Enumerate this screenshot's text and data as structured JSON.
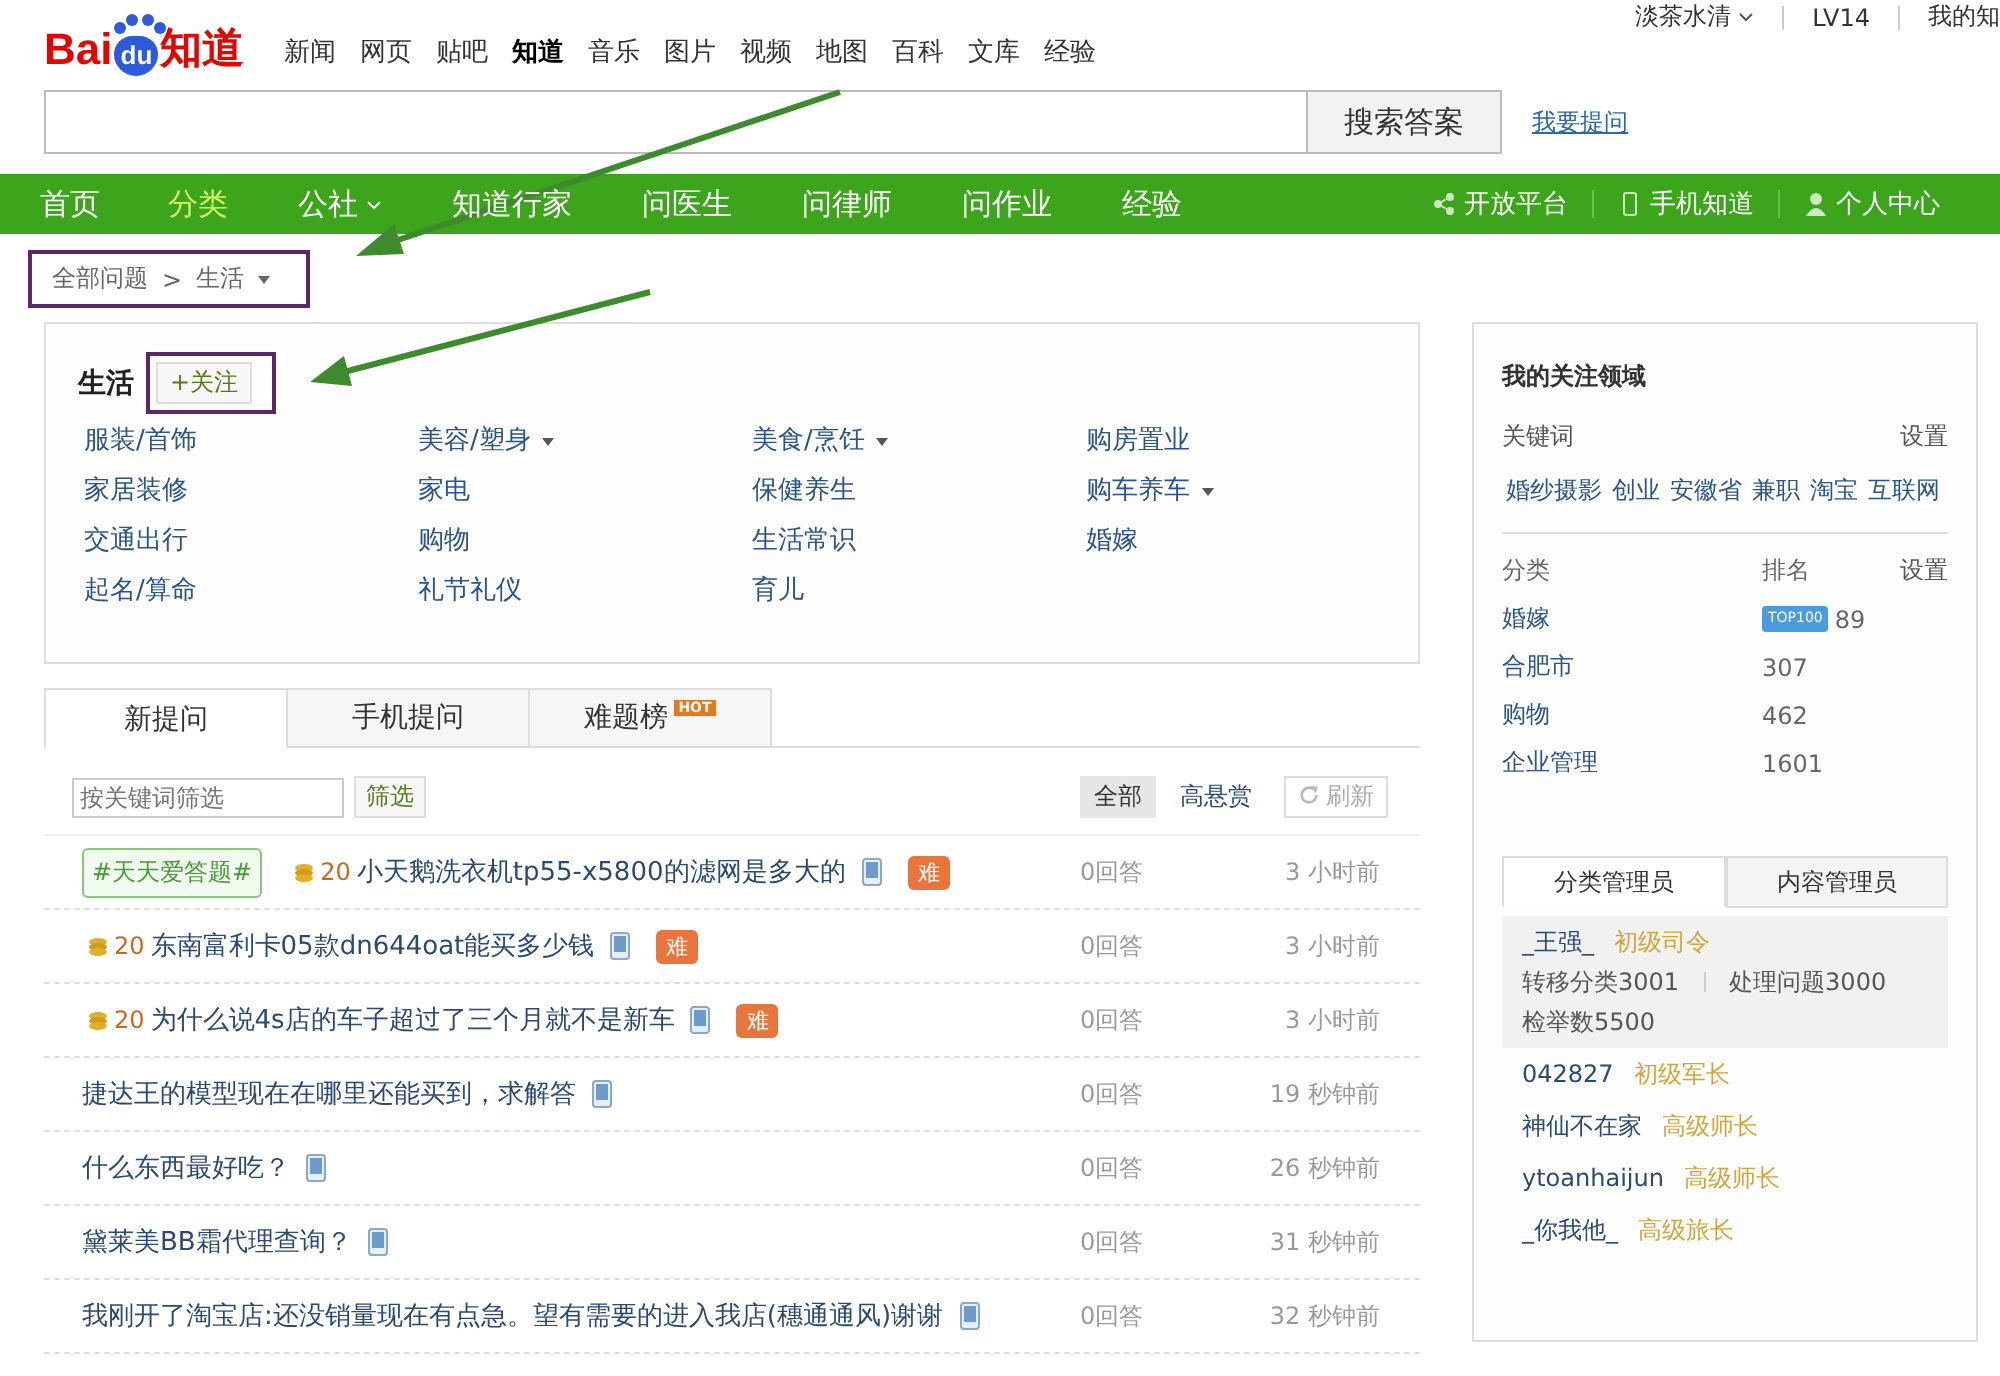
{
  "logo": {
    "part1": "Bai",
    "part2": "du",
    "part3": "知道"
  },
  "top_nav": [
    {
      "label": "新闻",
      "selected": false
    },
    {
      "label": "网页",
      "selected": false
    },
    {
      "label": "贴吧",
      "selected": false
    },
    {
      "label": "知道",
      "selected": true
    },
    {
      "label": "音乐",
      "selected": false
    },
    {
      "label": "图片",
      "selected": false
    },
    {
      "label": "视频",
      "selected": false
    },
    {
      "label": "地图",
      "selected": false
    },
    {
      "label": "百科",
      "selected": false
    },
    {
      "label": "文库",
      "selected": false
    },
    {
      "label": "经验",
      "selected": false
    }
  ],
  "user_bar": {
    "username": "淡茶水清",
    "level": "LV14",
    "my": "我的知"
  },
  "search": {
    "button": "搜索答案",
    "ask_link": "我要提问"
  },
  "main_nav": [
    {
      "label": "首页",
      "selected": false,
      "has_menu": false
    },
    {
      "label": "分类",
      "selected": true,
      "has_menu": false
    },
    {
      "label": "公社",
      "selected": false,
      "has_menu": true
    },
    {
      "label": "知道行家",
      "selected": false,
      "has_menu": false
    },
    {
      "label": "问医生",
      "selected": false,
      "has_menu": false
    },
    {
      "label": "问律师",
      "selected": false,
      "has_menu": false
    },
    {
      "label": "问作业",
      "selected": false,
      "has_menu": false
    },
    {
      "label": "经验",
      "selected": false,
      "has_menu": false
    }
  ],
  "nav_right": [
    {
      "kind": "share",
      "label": "开放平台"
    },
    {
      "kind": "phone",
      "label": "手机知道"
    },
    {
      "kind": "person",
      "label": "个人中心"
    }
  ],
  "breadcrumb": {
    "root": "全部问题",
    "separator": ">",
    "current": "生活"
  },
  "category": {
    "title": "生活",
    "follow": "+关注",
    "items": [
      {
        "label": "服装/首饰",
        "has_menu": false
      },
      {
        "label": "美容/塑身",
        "has_menu": true
      },
      {
        "label": "美食/烹饪",
        "has_menu": true
      },
      {
        "label": "购房置业",
        "has_menu": false
      },
      {
        "label": "家居装修",
        "has_menu": false
      },
      {
        "label": "家电",
        "has_menu": false
      },
      {
        "label": "保健养生",
        "has_menu": false
      },
      {
        "label": "购车养车",
        "has_menu": true
      },
      {
        "label": "交通出行",
        "has_menu": false
      },
      {
        "label": "购物",
        "has_menu": false
      },
      {
        "label": "生活常识",
        "has_menu": false
      },
      {
        "label": "婚嫁",
        "has_menu": false
      },
      {
        "label": "起名/算命",
        "has_menu": false
      },
      {
        "label": "礼节礼仪",
        "has_menu": false
      },
      {
        "label": "育儿",
        "has_menu": false
      }
    ]
  },
  "tabs": [
    {
      "label": "新提问",
      "selected": true
    },
    {
      "label": "手机提问",
      "selected": false
    },
    {
      "label": "难题榜",
      "selected": false,
      "badge": "HOT"
    }
  ],
  "filter": {
    "placeholder": "按关键词筛选",
    "button": "筛选",
    "options": [
      {
        "label": "全部",
        "selected": true
      },
      {
        "label": "高悬赏",
        "selected": false
      }
    ],
    "refresh": "刷新"
  },
  "questions": [
    {
      "tag": "#天天爱答题#",
      "reward": "20",
      "title": "小天鹅洗衣机tp55-x5800的滤网是多大的",
      "difficulty_badge": "难",
      "answers": "0回答",
      "time": "3 小时前"
    },
    {
      "reward": "20",
      "title": "东南富利卡05款dn644oat能买多少钱",
      "difficulty_badge": "难",
      "answers": "0回答",
      "time": "3 小时前"
    },
    {
      "reward": "20",
      "title": "为什么说4s店的车子超过了三个月就不是新车",
      "difficulty_badge": "难",
      "answers": "0回答",
      "time": "3 小时前"
    },
    {
      "title": "捷达王的模型现在在哪里还能买到，求解答",
      "answers": "0回答",
      "time": "19 秒钟前"
    },
    {
      "title": "什么东西最好吃？",
      "answers": "0回答",
      "time": "26 秒钟前"
    },
    {
      "title": "黛莱美BB霜代理查询？",
      "answers": "0回答",
      "time": "31 秒钟前"
    },
    {
      "title": "我刚开了淘宝店:还没销量现在有点急。望有需要的进入我店(穗通通风)谢谢",
      "answers": "0回答",
      "time": "32 秒钟前"
    }
  ],
  "sidebar": {
    "title": "我的关注领域",
    "keywords_label": "关键词",
    "keywords_setting": "设置",
    "keywords": [
      "婚纱摄影",
      "创业",
      "安徽省",
      "兼职",
      "淘宝",
      "互联网"
    ],
    "col_category": "分类",
    "col_rank": "排名",
    "rank_setting": "设置",
    "ranks": [
      {
        "category": "婚嫁",
        "badge": "TOP100",
        "rank": "89"
      },
      {
        "category": "合肥市",
        "rank": "307"
      },
      {
        "category": "购物",
        "rank": "462"
      },
      {
        "category": "企业管理",
        "rank": "1601"
      }
    ],
    "manager_tabs": [
      {
        "label": "分类管理员",
        "selected": true
      },
      {
        "label": "内容管理员",
        "selected": false
      }
    ],
    "managers": [
      {
        "name": "_王强_",
        "title": "初级司令",
        "expanded": true,
        "stats": [
          "转移分类3001",
          "处理问题3000",
          "检举数5500"
        ]
      },
      {
        "name": "042827",
        "title": "初级军长",
        "expanded": false
      },
      {
        "name": "神仙不在家",
        "title": "高级师长",
        "expanded": false
      },
      {
        "name": "ytoanhaijun",
        "title": "高级师长",
        "expanded": false
      },
      {
        "name": "_你我他_",
        "title": "高级旅长",
        "expanded": false
      }
    ]
  }
}
